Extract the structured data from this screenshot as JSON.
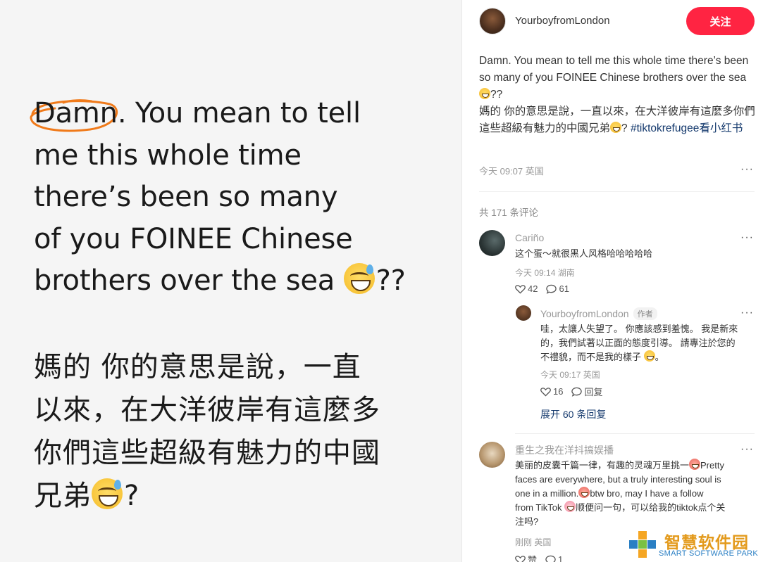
{
  "image": {
    "english_lines": [
      "Damn. You mean to tell",
      "me this whole time",
      "there’s been so many",
      "of you FOINEE Chinese",
      "brothers over the sea",
      "??"
    ],
    "chinese_lines": [
      "媽的 你的意思是說，一直",
      "以來，在大洋彼岸有這麼多",
      "你們這些超級有魅力的中國",
      "兄弟",
      "?"
    ],
    "circle_color": "#f07a1a"
  },
  "author": {
    "name": "YourboyfromLondon",
    "follow_label": "关注",
    "follow_color": "#ff2442"
  },
  "post": {
    "text_en": "Damn. You mean to tell me this whole time there’s been so many of you FOINEE Chinese brothers over the sea",
    "text_en_tail": "??",
    "text_zh": "媽的 你的意思是說，一直以來，在大洋彼岸有這麼多你們這些超級有魅力的中國兄弟",
    "hashtag": "#tiktokrefugee看小红书",
    "meta": "今天 09:07 英国",
    "more": "···"
  },
  "comments_header": "共 171 条评论",
  "comments": [
    {
      "name": "Cariño",
      "text": "这个蛋～就很黑人风格哈哈哈哈哈",
      "meta": "今天 09:14 湖南",
      "likes": "42",
      "replies": "61",
      "more": "···"
    },
    {
      "name": "YourboyfromLondon",
      "tag": "作者",
      "text_lines": [
        "哇，太讓人失望了。 你應該感到羞愧。 我是新來",
        "的，我們試著以正面的態度引導。 請專注於您的",
        "不禮貌，而不是我的樣子"
      ],
      "text_end": "。",
      "meta": "今天 09:17 英国",
      "likes": "16",
      "reply_label": "回复",
      "more": "···"
    },
    {
      "name": "重生之我在洋抖搞娱播",
      "text_lines": [
        "美丽的皮囊千篇一律，有趣的灵魂万里挑一",
        "faces are everywhere, but a truly interesting soul is",
        "one in a million.",
        "from TikTok",
        "注吗?"
      ],
      "text_line1_tail": "Pretty",
      "text_line3_tail": "btw bro, may I have a follow",
      "text_line4_tail": "顺便问一句，可以给我的tiktok点个关",
      "meta": "刚刚 英国",
      "likes": "赞",
      "replies": "1",
      "more": "···"
    }
  ],
  "expand_label": "展开 60 条回复",
  "watermark": {
    "cn": "智慧软件园",
    "en": "SMART SOFTWARE PARK"
  }
}
